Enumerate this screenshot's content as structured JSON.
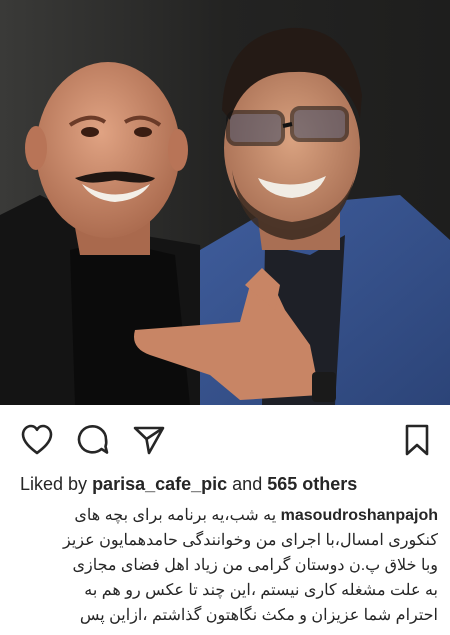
{
  "post": {
    "liked_by_prefix": "Liked by",
    "liked_by_user": "parisa_cafe_pic",
    "liked_by_and": "and",
    "liked_by_count": "565 others",
    "caption_user": "masoudroshanpajoh",
    "caption_lines": [
      "یه شب،یه برنامه برای بچه های",
      "کنکوری امسال،با اجرای من وخوانندگی حامدهمایون عزیز",
      "وبا خلاق پ.ن دوستان گرامی من زیاد اهل فضای مجازی",
      "به علت مشغله کاری نیستم ،این چند تا عکس رو هم به",
      "احترام شما عزیزان و مکث نگاهتون گذاشتم ،ازاین پس"
    ]
  },
  "icons": {
    "like": "heart-icon",
    "comment": "comment-icon",
    "share": "paper-plane-icon",
    "save": "bookmark-icon"
  },
  "colors": {
    "text": "#262626",
    "background": "#ffffff"
  }
}
